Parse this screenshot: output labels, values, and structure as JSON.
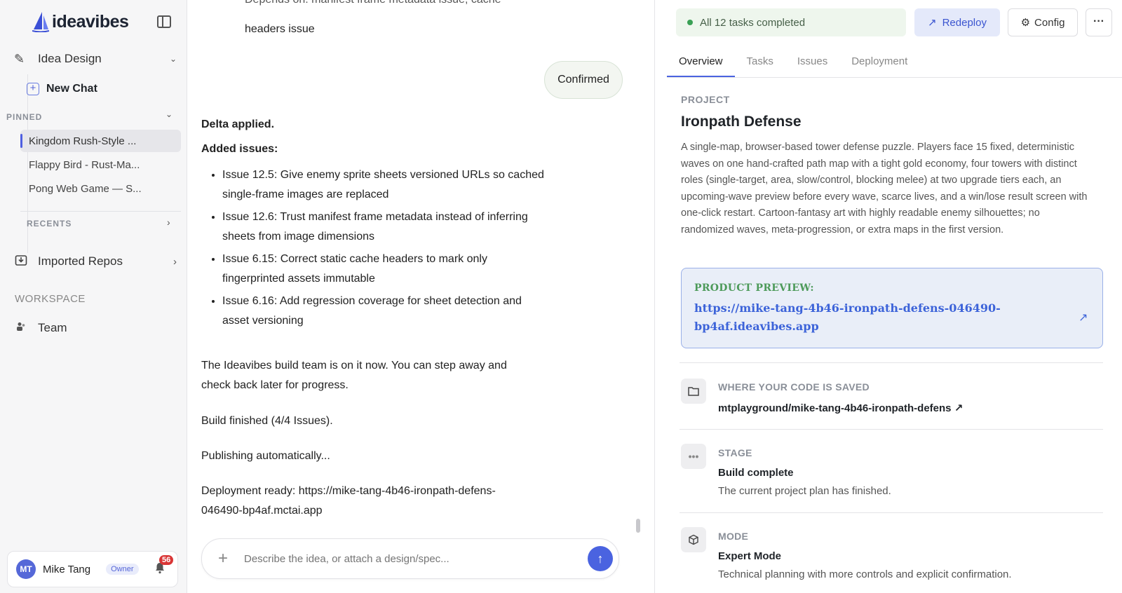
{
  "brand": {
    "name": "ideavibes"
  },
  "sidebar": {
    "project_label": "Idea Design",
    "new_chat_label": "New Chat",
    "pinned_header": "PINNED",
    "pinned_items": [
      {
        "label": "Kingdom Rush-Style ..."
      },
      {
        "label": "Flappy Bird - Rust-Ma..."
      },
      {
        "label": "Pong Web Game — S..."
      }
    ],
    "recents_header": "RECENTS",
    "imported_repos_label": "Imported Repos",
    "workspace_header": "WORKSPACE",
    "team_label": "Team",
    "user": {
      "initials": "MT",
      "name": "Mike Tang",
      "role": "Owner",
      "notifications": "56"
    }
  },
  "chat": {
    "top_partial_line1": "Depends on: manifest frame metadata issue, cache",
    "top_partial_line2": "headers issue",
    "confirmed_label": "Confirmed",
    "delta_applied": "Delta applied.",
    "added_issues_header": "Added issues:",
    "issues": [
      {
        "text": "Issue 12.5: Give enemy sprite sheets versioned URLs so cached single-frame images are replaced"
      },
      {
        "text": "Issue 12.6: Trust manifest frame metadata instead of inferring sheets from image dimensions"
      },
      {
        "text": "Issue 6.15: Correct static cache headers to mark only fingerprinted assets immutable"
      },
      {
        "text": "Issue 6.16: Add regression coverage for sheet detection and asset versioning"
      }
    ],
    "build_team_msg": "The Ideavibes build team is on it now. You can step away and check back later for progress.",
    "build_finished": "Build finished (4/4 Issues).",
    "publishing": "Publishing automatically...",
    "deployment_ready": "Deployment ready: https://mike-tang-4b46-ironpath-defens-046490-bp4af.mctai.app",
    "composer_placeholder": "Describe the idea, or attach a design/spec..."
  },
  "right_panel": {
    "status_text": "All 12 tasks completed",
    "redeploy_label": "Redeploy",
    "config_label": "Config",
    "more_label": "···",
    "tabs": [
      {
        "label": "Overview"
      },
      {
        "label": "Tasks"
      },
      {
        "label": "Issues"
      },
      {
        "label": "Deployment"
      }
    ],
    "project_label": "PROJECT",
    "project_title": "Ironpath Defense",
    "project_description": "A single-map, browser-based tower defense puzzle. Players face 15 fixed, deterministic waves on one hand-crafted path map with a tight gold economy, four towers with distinct roles (single-target, area, slow/control, blocking melee) at two upgrade tiers each, an upcoming-wave preview before every wave, scarce lives, and a win/lose result screen with one-click restart. Cartoon-fantasy art with highly readable enemy silhouettes; no randomized waves, meta-progression, or extra maps in the first version.",
    "preview_label": "PRODUCT PREVIEW:",
    "preview_url": "https://mike-tang-4b46-ironpath-defens-046490-bp4af.ideavibes.app",
    "code_label": "WHERE YOUR CODE IS SAVED",
    "code_repo": "mtplayground/mike-tang-4b46-ironpath-defens ↗",
    "stage_label": "STAGE",
    "stage_value": "Build complete",
    "stage_sub": "The current project plan has finished.",
    "mode_label": "MODE",
    "mode_value": "Expert Mode",
    "mode_sub": "Technical planning with more controls and explicit confirmation."
  },
  "colors": {
    "accent": "#4a63e0",
    "success": "#3aa055",
    "link": "#3c63d9"
  }
}
